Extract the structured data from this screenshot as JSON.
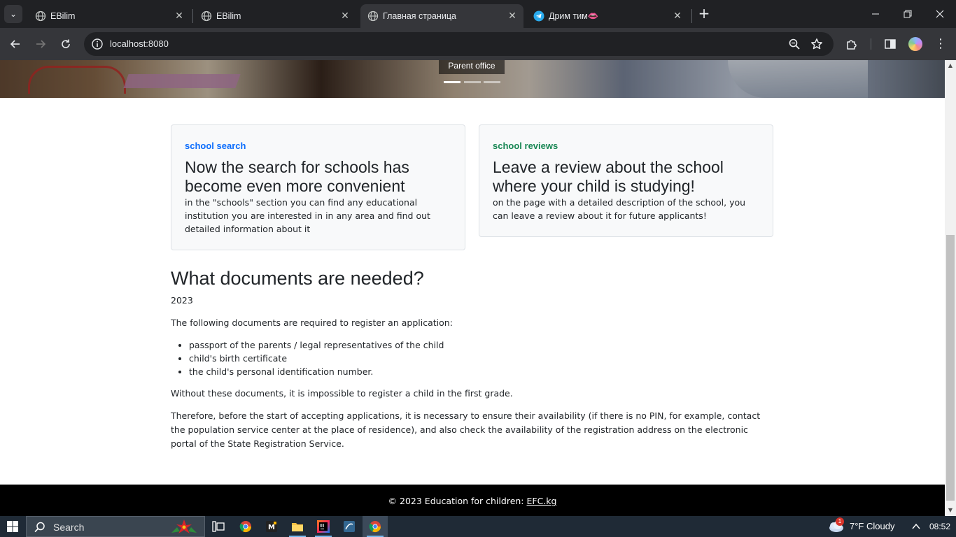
{
  "browser": {
    "tabs": [
      {
        "title": "EBilim",
        "close": "✕"
      },
      {
        "title": "EBilim",
        "close": "✕"
      },
      {
        "title": "Главная страница",
        "close": "✕"
      },
      {
        "title": "Дрим тим👄",
        "close": "✕"
      }
    ],
    "new_tab": "+",
    "url": "localhost:8080"
  },
  "hero": {
    "caption": "Parent office"
  },
  "cards": [
    {
      "kicker": "school search",
      "title": "Now the search for schools has become even more convenient",
      "text": "in the \"schools\" section you can find any educational institution you are interested in in any area and find out detailed information about it"
    },
    {
      "kicker": "school reviews",
      "title": "Leave a review about the school where your child is studying!",
      "text": "on the page with a detailed description of the school, you can leave a review about it for future applicants!"
    }
  ],
  "documents": {
    "heading": "What documents are needed?",
    "year": "2023",
    "intro": "The following documents are required to register an application:",
    "items": [
      "passport of the parents / legal representatives of the child",
      "child's birth certificate",
      "the child's personal identification number."
    ],
    "warning": "Without these documents, it is impossible to register a child in the first grade.",
    "advice": "Therefore, before the start of accepting applications, it is necessary to ensure their availability (if there is no PIN, for example, contact the population service center at the place of residence), and also check the availability of the registration address on the electronic portal of the State Registration Service."
  },
  "footer": {
    "text": "© 2023 Education for children: ",
    "link": "EFC.kg"
  },
  "taskbar": {
    "search_label": "Search",
    "weather": "7°F  Cloudy",
    "weather_badge": "1",
    "time": "08:52"
  },
  "colors": {
    "link_blue": "#0d6efd",
    "link_green": "#198754",
    "chrome_dark": "#202124",
    "chrome_toolbar": "#35363a"
  }
}
